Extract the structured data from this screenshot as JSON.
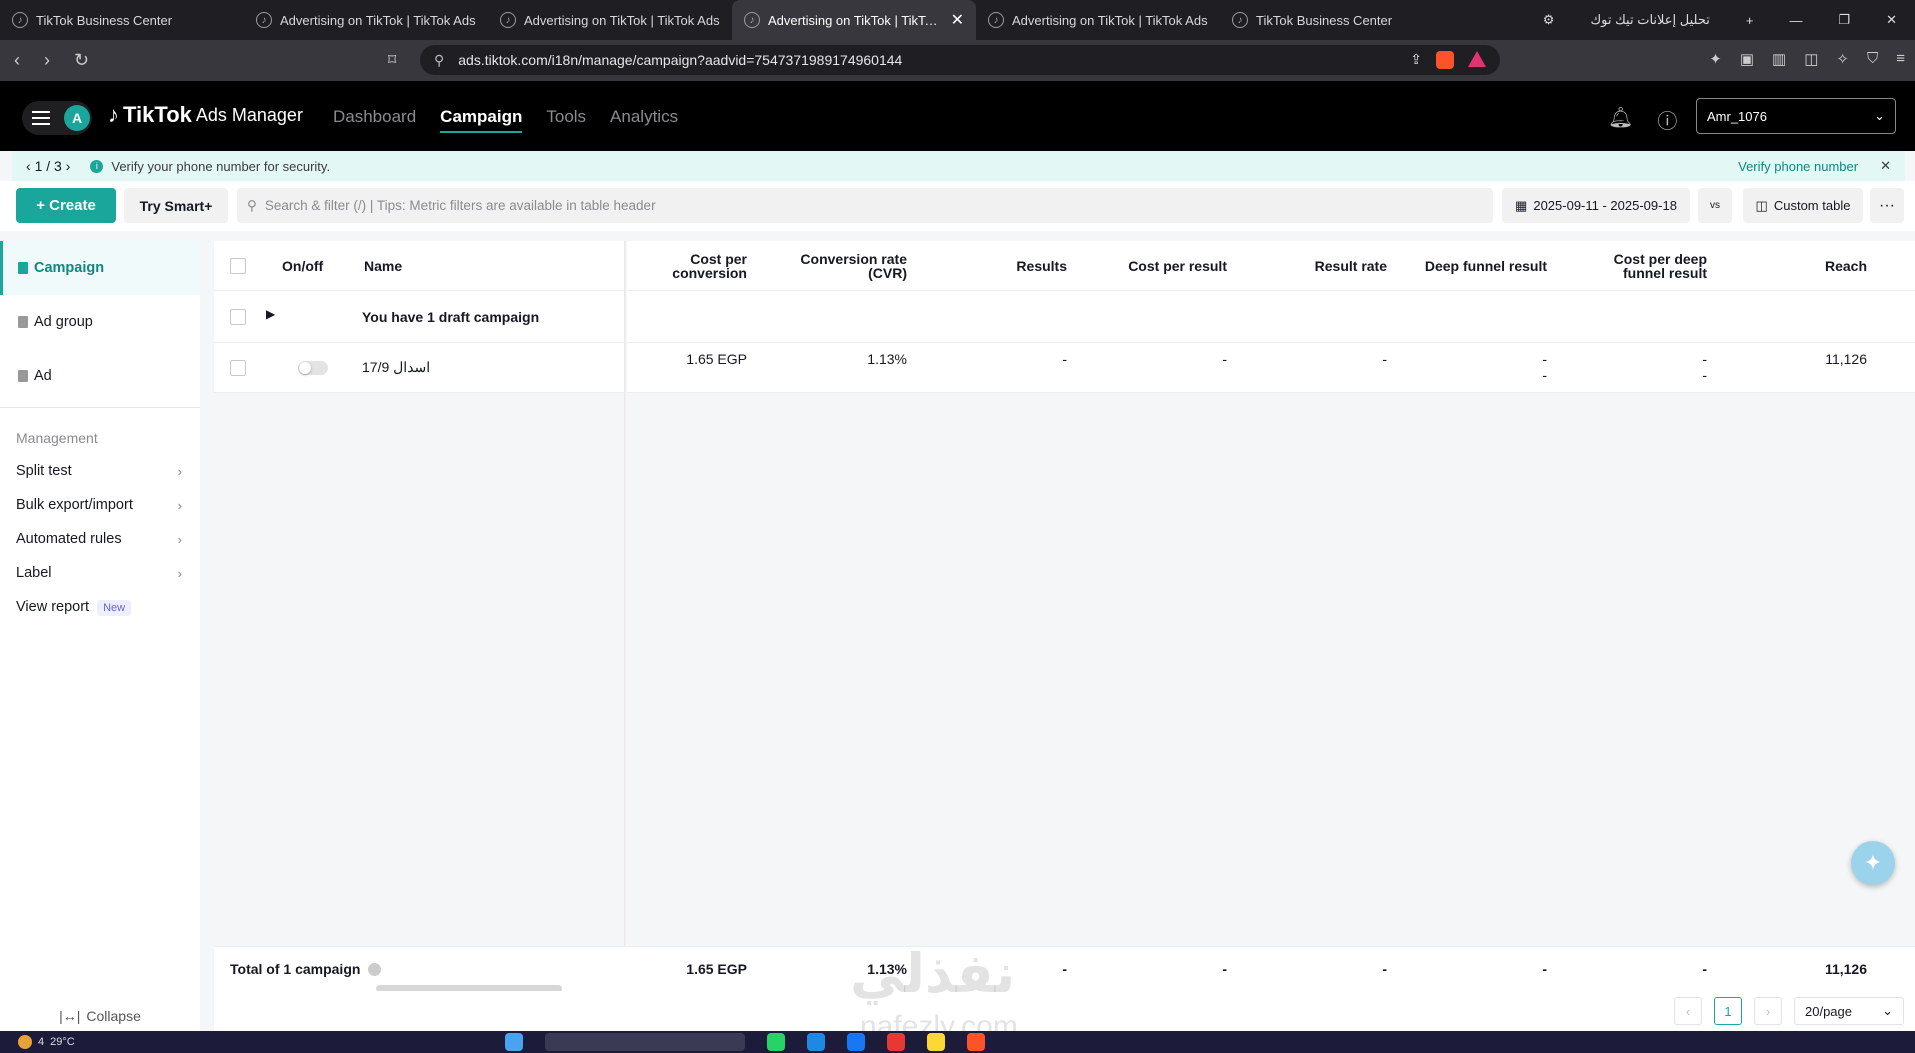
{
  "browser": {
    "tabs": [
      {
        "title": "TikTok Business Center",
        "active": false
      },
      {
        "title": "Advertising on TikTok | TikTok Ads",
        "active": false
      },
      {
        "title": "Advertising on TikTok | TikTok Ads",
        "active": false
      },
      {
        "title": "Advertising on TikTok | TikTok Ads",
        "active": true
      },
      {
        "title": "Advertising on TikTok | TikTok Ads",
        "active": false
      },
      {
        "title": "TikTok Business Center",
        "active": false
      }
    ],
    "rtl_tab_title": "تحليل إعلانات تيك توك",
    "url": "ads.tiktok.com/i18n/manage/campaign?aadvid=7547371989174960144"
  },
  "app": {
    "avatar_letter": "A",
    "logo": "TikTok",
    "logo_sub": "Ads Manager",
    "nav": [
      "Dashboard",
      "Campaign",
      "Tools",
      "Analytics"
    ],
    "active_nav": "Campaign",
    "account": "Amr_1076"
  },
  "notice": {
    "pager": "1 / 3",
    "message": "Verify your phone number for security.",
    "action": "Verify phone number"
  },
  "toolbar": {
    "create": "+ Create",
    "smart": "Try Smart+",
    "search_placeholder": "Search & filter (/) | Tips: Metric filters are available in table header",
    "date_range": "2025-09-11 - 2025-09-18",
    "compare": "vs",
    "custom_table": "Custom table",
    "more": "···"
  },
  "sidebar": {
    "levels": [
      "Campaign",
      "Ad group",
      "Ad"
    ],
    "management_title": "Management",
    "management": [
      "Split test",
      "Bulk export/import",
      "Automated rules",
      "Label",
      "View report"
    ],
    "new_badge": "New",
    "collapse": "Collapse"
  },
  "table": {
    "headers": {
      "onoff": "On/off",
      "name": "Name",
      "cost_per_conversion": "Cost per conversion",
      "cvr": "Conversion rate (CVR)",
      "results": "Results",
      "cost_per_result": "Cost per result",
      "result_rate": "Result rate",
      "deep_funnel": "Deep funnel result",
      "cost_deep_funnel": "Cost per deep funnel result",
      "reach": "Reach"
    },
    "draft_row": "You have 1 draft campaign",
    "row": {
      "name": "اسدال 17/9",
      "cost_per_conversion": "1.65 EGP",
      "cvr": "1.13%",
      "results": "-",
      "cost_per_result": "-",
      "result_rate": "-",
      "deep_funnel": "-",
      "deep_funnel_2": "-",
      "cost_deep_funnel": "-",
      "cost_deep_funnel_2": "-",
      "reach": "11,126"
    },
    "total": {
      "label": "Total of 1 campaign",
      "cost_per_conversion": "1.65 EGP",
      "cvr": "1.13%",
      "results": "-",
      "cost_per_result": "-",
      "result_rate": "-",
      "deep_funnel": "-",
      "cost_deep_funnel": "-",
      "reach": "11,126"
    },
    "pagination": {
      "page": "1",
      "per_page": "20/page"
    }
  },
  "watermark": {
    "arabic": "نفذلي",
    "latin": "nafezly.com"
  },
  "taskbar": {
    "weather": "29°C",
    "badge": "4"
  }
}
